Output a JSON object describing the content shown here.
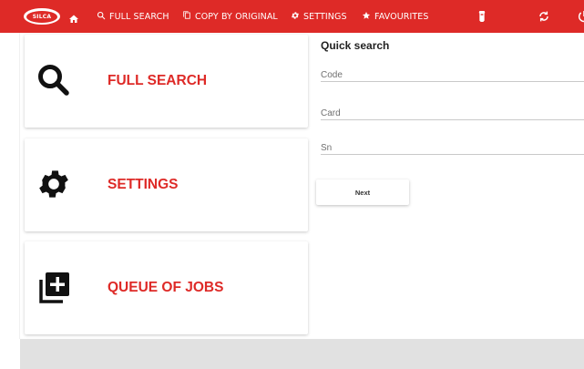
{
  "brand": {
    "logo_text": "SILCA",
    "accent": "#de2a27"
  },
  "nav": {
    "home_icon": "home-icon",
    "items": [
      {
        "label": "FULL SEARCH",
        "icon": "search-icon"
      },
      {
        "label": "COPY BY ORIGINAL",
        "icon": "copy-icon"
      },
      {
        "label": "SETTINGS",
        "icon": "gear-icon"
      },
      {
        "label": "FAVOURITES",
        "icon": "star-icon"
      }
    ],
    "right_icons": [
      "key-icon",
      "sync-icon",
      "power-icon"
    ]
  },
  "cards": [
    {
      "label": "FULL SEARCH",
      "icon": "search-icon"
    },
    {
      "label": "SETTINGS",
      "icon": "gear-icon"
    },
    {
      "label": "QUEUE OF JOBS",
      "icon": "queue-add-icon"
    }
  ],
  "quick_search": {
    "title": "Quick search",
    "fields": [
      {
        "placeholder": "Code",
        "value": ""
      },
      {
        "placeholder": "Card",
        "value": ""
      },
      {
        "placeholder": "Sn",
        "value": ""
      }
    ],
    "next_label": "Next"
  }
}
